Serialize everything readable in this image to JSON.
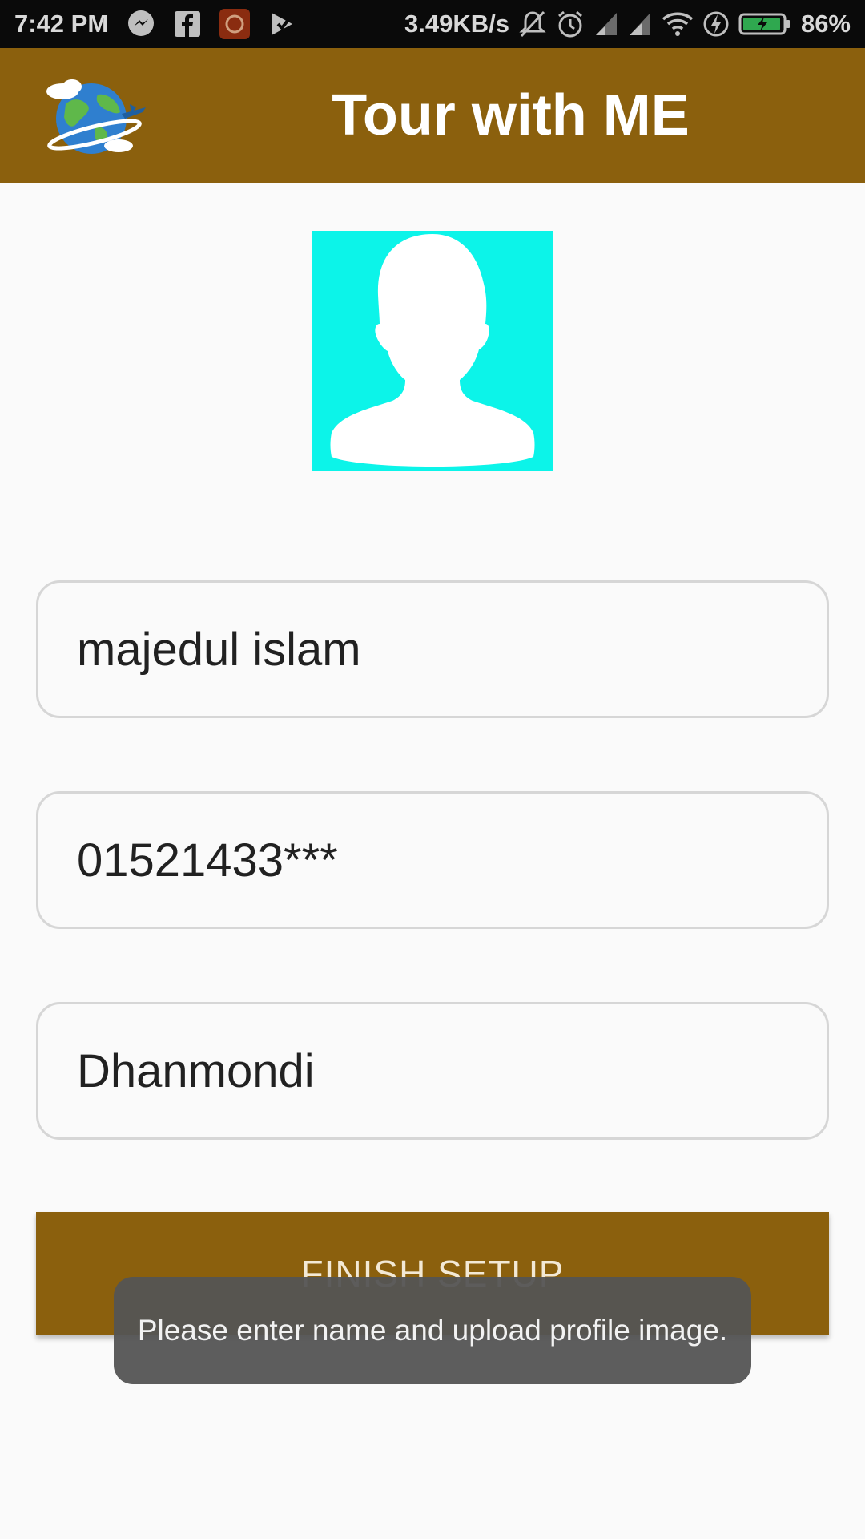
{
  "status_bar": {
    "time": "7:42 PM",
    "net_speed": "3.49KB/s",
    "battery": "86%",
    "left_icons": [
      "messenger-icon",
      "facebook-icon",
      "app-icon",
      "play-check-icon"
    ],
    "right_icons": [
      "mute-bell-icon",
      "alarm-icon",
      "signal-icon",
      "signal-icon",
      "wifi-icon",
      "charging-bolt-icon",
      "battery-icon"
    ]
  },
  "app_bar": {
    "title": "Tour with ME",
    "logo": "globe-plane-logo",
    "color": "#8b600d"
  },
  "profile": {
    "avatar_icon": "person-silhouette-icon",
    "avatar_color": "#0cf4e9"
  },
  "form": {
    "name_value": "majedul islam",
    "phone_value": "01521433***",
    "area_value": "Dhanmondi"
  },
  "finish_button": {
    "label": "FINISH SETUP"
  },
  "toast": {
    "message": "Please enter name and upload profile image."
  }
}
